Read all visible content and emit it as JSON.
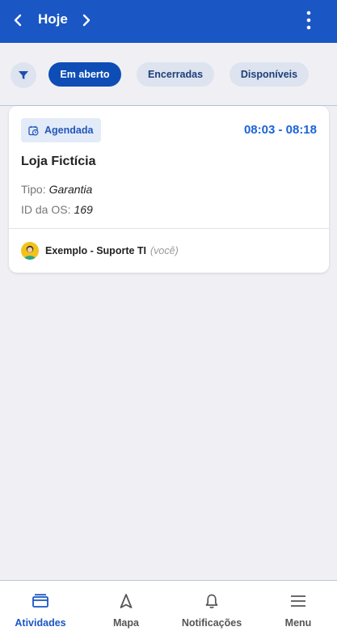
{
  "header": {
    "title": "Hoje",
    "prev_icon": "chevron-left-icon",
    "next_icon": "chevron-right-icon",
    "more_icon": "more-vertical-icon",
    "background": "#1a56c4"
  },
  "filters": {
    "filter_icon": "filter-icon",
    "chips": [
      {
        "label": "Em aberto",
        "active": true
      },
      {
        "label": "Encerradas",
        "active": false
      },
      {
        "label": "Disponíveis",
        "active": false
      }
    ]
  },
  "activity": {
    "status": "Agendada",
    "status_icon": "calendar-clock-icon",
    "time": "08:03 - 08:18",
    "title": "Loja Fictícia",
    "type_label": "Tipo:",
    "type_value": "Garantia",
    "id_label": "ID da OS:",
    "id_value": "169",
    "assignee_name": "Exemplo - Suporte TI",
    "assignee_you": "(você)"
  },
  "bottom_nav": [
    {
      "label": "Atividades",
      "icon": "activities-icon",
      "active": true
    },
    {
      "label": "Mapa",
      "icon": "navigation-arrow-icon",
      "active": false
    },
    {
      "label": "Notificações",
      "icon": "bell-icon",
      "active": false
    },
    {
      "label": "Menu",
      "icon": "hamburger-menu-icon",
      "active": false
    }
  ],
  "colors": {
    "accent": "#1a56c4",
    "chip_active": "#0e4db5",
    "chip_inactive": "#dde3ef",
    "time": "#1a63d8"
  }
}
